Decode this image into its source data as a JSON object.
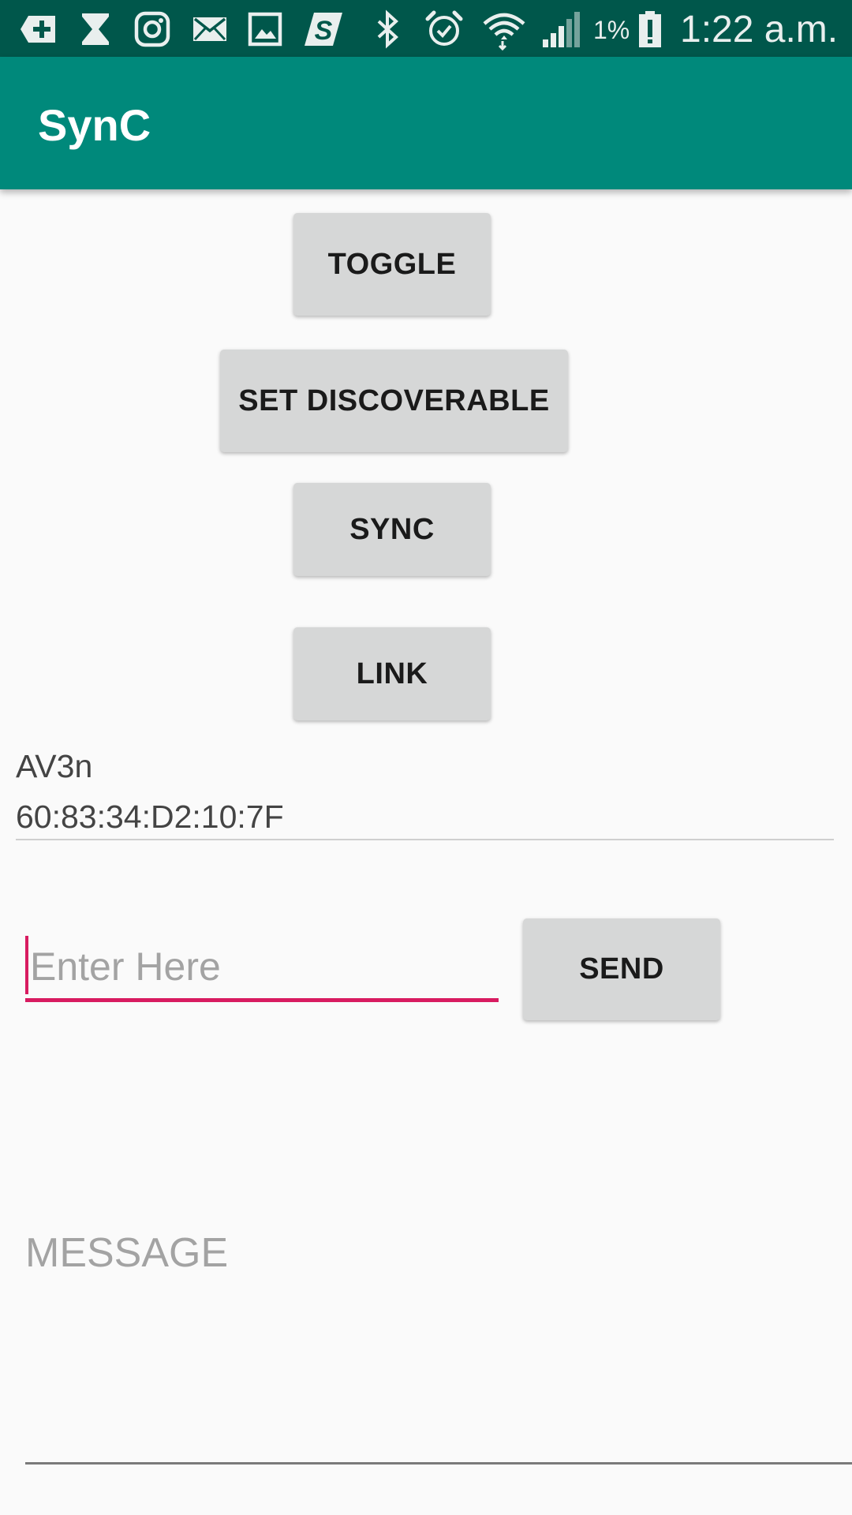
{
  "status_bar": {
    "icons": [
      "add-box-icon",
      "hourglass-icon",
      "instagram-icon",
      "mail-icon",
      "gallery-icon",
      "s-app-icon",
      "bluetooth-icon",
      "alarm-icon",
      "wifi-icon",
      "signal-icon",
      "battery-low-icon"
    ],
    "battery_percent": "1%",
    "time": "1:22 a.m."
  },
  "app_bar": {
    "title": "SynC"
  },
  "buttons": {
    "toggle": "TOGGLE",
    "set_discoverable": "SET DISCOVERABLE",
    "sync": "SYNC",
    "link": "LINK",
    "send": "SEND"
  },
  "device": {
    "name": "AV3n",
    "address": "60:83:34:D2:10:7F"
  },
  "input": {
    "placeholder": "Enter Here",
    "value": ""
  },
  "message": {
    "hint": "MESSAGE"
  },
  "colors": {
    "status_bar": "#00574b",
    "app_bar": "#00897b",
    "accent": "#d81b60",
    "button": "#d6d7d7"
  }
}
